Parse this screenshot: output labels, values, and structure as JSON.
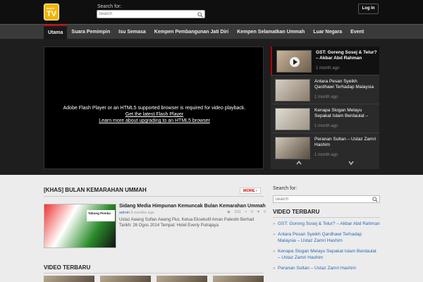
{
  "header": {
    "logo_top": "suara",
    "logo_bottom": "TV",
    "search_label": "Search for:",
    "search_placeholder": "Search",
    "login_label": "Log In"
  },
  "nav": {
    "items": [
      {
        "label": "Utama",
        "active": true
      },
      {
        "label": "Suara Pemimpin"
      },
      {
        "label": "Isu Semasa"
      },
      {
        "label": "Kempen Pembangunan Jati Diri"
      },
      {
        "label": "Kempen Selamatkan Ummah"
      },
      {
        "label": "Luar Negara"
      },
      {
        "label": "Event"
      }
    ]
  },
  "player": {
    "line1": "Adobe Flash Player or an HTML5 supported browser is required for video playback.",
    "line2": "Get the latest Flash Player",
    "line3": "Learn more about upgrading to an HTML5 browser"
  },
  "playlist": {
    "items": [
      {
        "title": "GST: Goreng Sosej & Telur? – Akbar Abd Rahman",
        "time": "1 month ago"
      },
      {
        "title": "Antara Pesan Syeikh Qardhawi Terhadap Malaysia",
        "time": "1 month ago"
      },
      {
        "title": "Kenapa Slogan Melayu Sepakat Islam Berdaulat –",
        "time": "1 month ago"
      },
      {
        "title": "Peranan Sultan – Ustaz Zamri Hashim",
        "time": "1 month ago"
      }
    ]
  },
  "main": {
    "section_title": "[KHAS] BULAN KEMARAHAN UMMAH",
    "more_label": "MORE ›",
    "feature": {
      "banner_text": "Tabung Pemba",
      "title": "Sidang Media Himpunan Kemuncak Bulan Kemarahan Ummah",
      "author": "admin",
      "time": "9 months ago",
      "views": "631",
      "comments": "0",
      "likes": "0",
      "description": "Ustaz Awang Sufian Awang Piut, Ketua Eksekutif Aman Palestin Berhad Tarikh: 26 Ogos 2014 Tempat: Hotel Everly Putrajaya"
    },
    "section2_title": "VIDEO TERBARU"
  },
  "sidebar": {
    "search_label": "Search for:",
    "search_placeholder": "Search",
    "title": "VIDEO TERBARU",
    "items": [
      "GST: Goreng Sosej & Telur? – Akbar Abd Rahman",
      "Antara Pesan Syeikh Qardhawi Terhadap Malaysia – Ustaz Zamri Hashim",
      "Kenapa Slogan Melayu Sepakat Islam Berdaulat – Ustaz Zamri Hashim",
      "Peranan Sultan – Ustaz Zamri Hashim"
    ]
  }
}
